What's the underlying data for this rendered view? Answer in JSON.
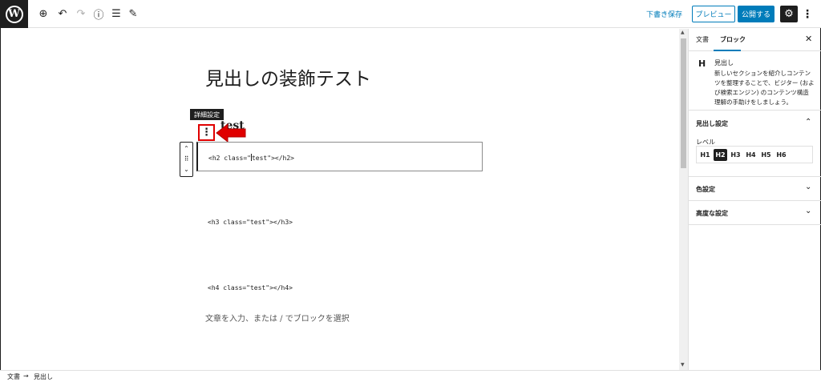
{
  "topbar": {
    "save_draft": "下書き保存",
    "preview": "プレビュー",
    "publish": "公開する"
  },
  "icons": [
    "wordpress-icon",
    "plus-icon",
    "undo-icon",
    "redo-icon",
    "info-icon",
    "list-view-icon",
    "edit-icon",
    "gear-icon",
    "more-vertical-icon"
  ],
  "editor": {
    "title": "見出しの装飾テスト",
    "tooltip": "詳細設定",
    "hidden_heading": "test",
    "code_lines": [
      "<h2 class=\"test\"></h2>",
      "<h3 class=\"test\"></h3>",
      "<h4 class=\"test\"></h4>"
    ],
    "code_h2_before": "<h2 class=\"",
    "code_h2_after": "test\"></h2>",
    "placeholder": "文章を入力、または / でブロックを選択"
  },
  "sidebar": {
    "tabs": [
      "文書",
      "ブロック"
    ],
    "active_tab": "ブロック",
    "block_card": {
      "icon": "H",
      "title": "見出し",
      "description": "新しいセクションを紹介しコンテンツを整理することで、ビジター (および検索エンジン) のコンテンツ構造理解の手助けをしましょう。"
    },
    "heading_settings": {
      "title": "見出し設定",
      "level_label": "レベル",
      "levels": [
        "H1",
        "H2",
        "H3",
        "H4",
        "H5",
        "H6"
      ],
      "selected": "H2"
    },
    "color_settings": "色設定",
    "advanced": "高度な設定"
  },
  "footer": {
    "breadcrumb": [
      "文書",
      "→",
      "見出し"
    ]
  },
  "colors": {
    "accent": "#007cba",
    "dark": "#1e1e1e",
    "highlight_red": "#e00000"
  }
}
